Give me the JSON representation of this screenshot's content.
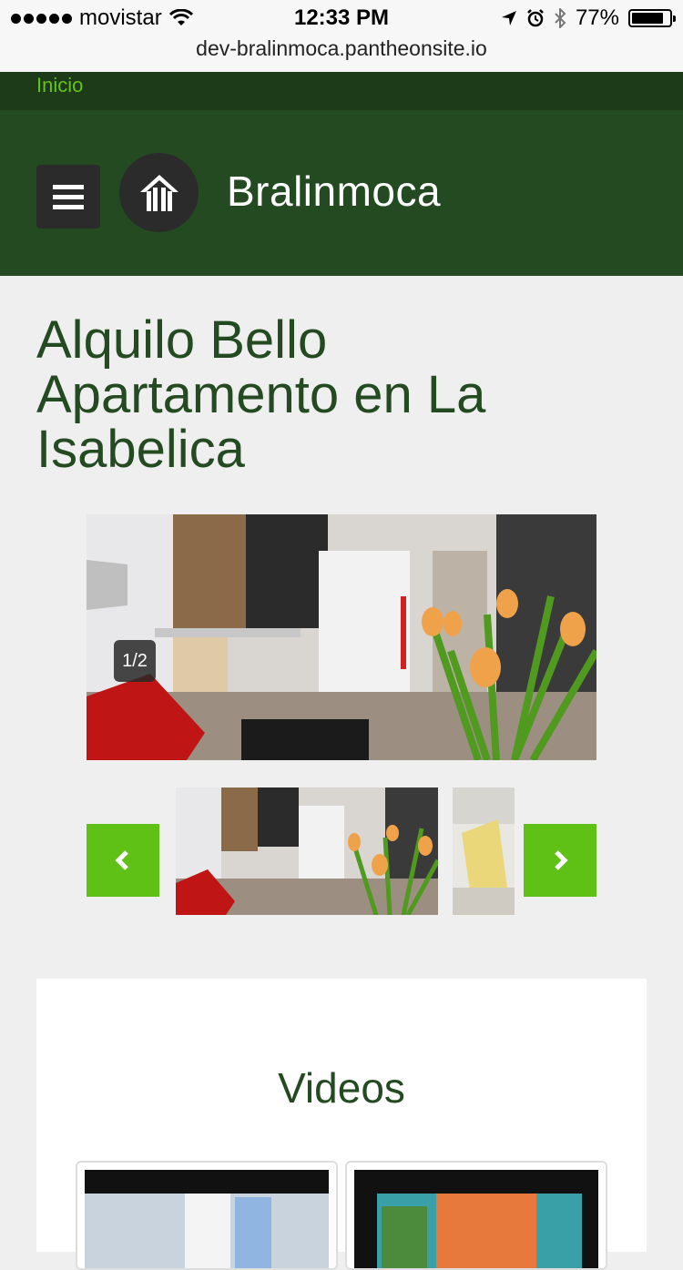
{
  "status_bar": {
    "carrier": "movistar",
    "time": "12:33 PM",
    "battery": "77%",
    "battery_level": 0.77,
    "url": "dev-bralinmoca.pantheonsite.io"
  },
  "top_nav": {
    "home_link": "Inicio",
    "link_color": "#63c21c"
  },
  "header": {
    "site_name": "Bralinmoca",
    "background": "#244a21",
    "menu_icon": "hamburger-icon",
    "logo_icon": "house-icon"
  },
  "page": {
    "title": "Alquilo Bello Apartamento en La Isabelica"
  },
  "gallery": {
    "counter": "1/2",
    "current": 1,
    "total": 2,
    "prev_icon": "chevron-left-icon",
    "next_icon": "chevron-right-icon",
    "accent": "#5fc116"
  },
  "videos": {
    "title": "Videos"
  }
}
